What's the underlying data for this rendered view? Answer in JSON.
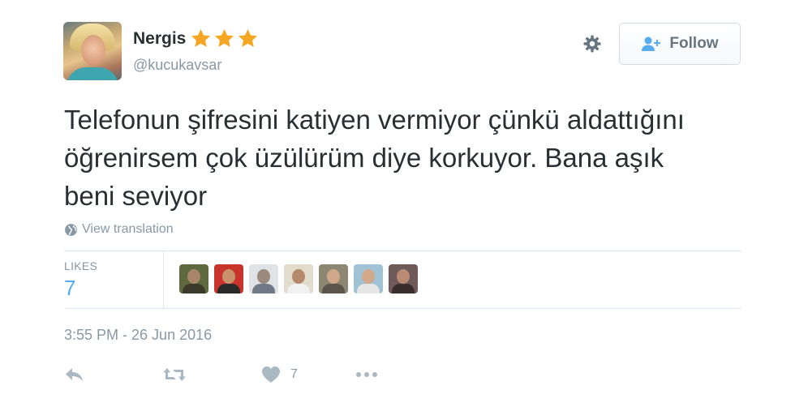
{
  "user": {
    "name": "Nergis",
    "handle": "@kucukavsar",
    "badge_icons": [
      "star-icon",
      "star-icon",
      "star-icon"
    ],
    "star_color": "#f5a623"
  },
  "header": {
    "settings_icon": "gear-icon",
    "follow_label": "Follow",
    "follow_icon": "add-user-icon"
  },
  "tweet": {
    "text": "Telefonun şifresini katiyen vermiyor çünkü aldattığını öğrenirsem çok üzülürüm diye korkuyor. Bana aşık beni seviyor",
    "translate_label": "View translation",
    "translate_icon": "globe-icon",
    "timestamp": "3:55 PM - 26 Jun 2016"
  },
  "stats": {
    "likes_label": "LIKES",
    "likes_count": "7",
    "liker_avatars": 7
  },
  "actions": {
    "reply_icon": "reply-icon",
    "retweet_icon": "retweet-icon",
    "like_icon": "heart-icon",
    "like_count": "7",
    "more_icon": "more-icon"
  },
  "colors": {
    "text": "#292f33",
    "muted": "#8899a6",
    "accent": "#55acee",
    "border": "#e1e8ed"
  }
}
